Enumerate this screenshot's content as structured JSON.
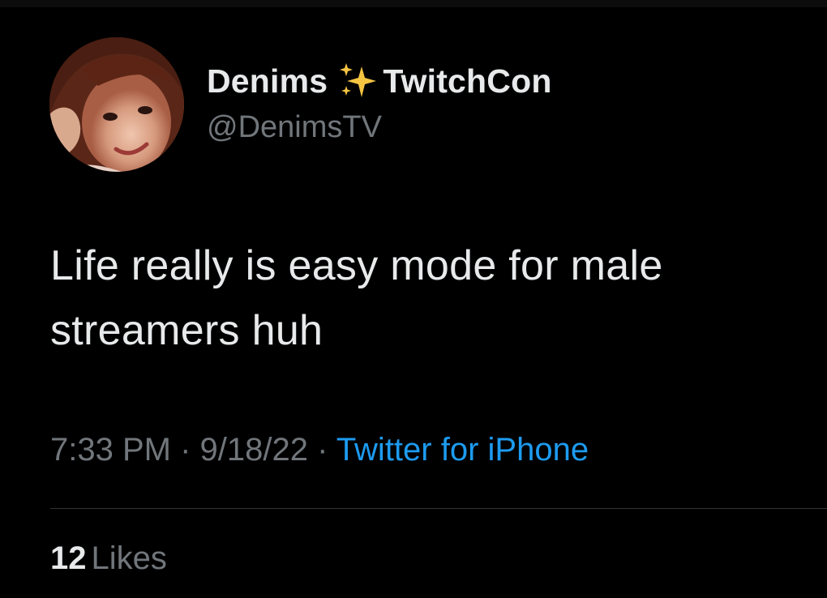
{
  "user": {
    "display_name": "Denims",
    "name_suffix": "TwitchCon",
    "handle": "@DenimsTV",
    "avatar_icon": "profile-photo"
  },
  "tweet": {
    "text": "Life really is easy mode for male streamers huh"
  },
  "meta": {
    "time": "7:33 PM",
    "separator": " · ",
    "date": "9/18/22",
    "source": "Twitter for iPhone"
  },
  "engagement": {
    "likes_count": "12",
    "likes_label": "Likes"
  },
  "colors": {
    "background": "#000000",
    "primary_text": "#e7e9ea",
    "secondary_text": "#71767b",
    "link": "#1d9bf0",
    "sparkle": "#f5c542"
  }
}
